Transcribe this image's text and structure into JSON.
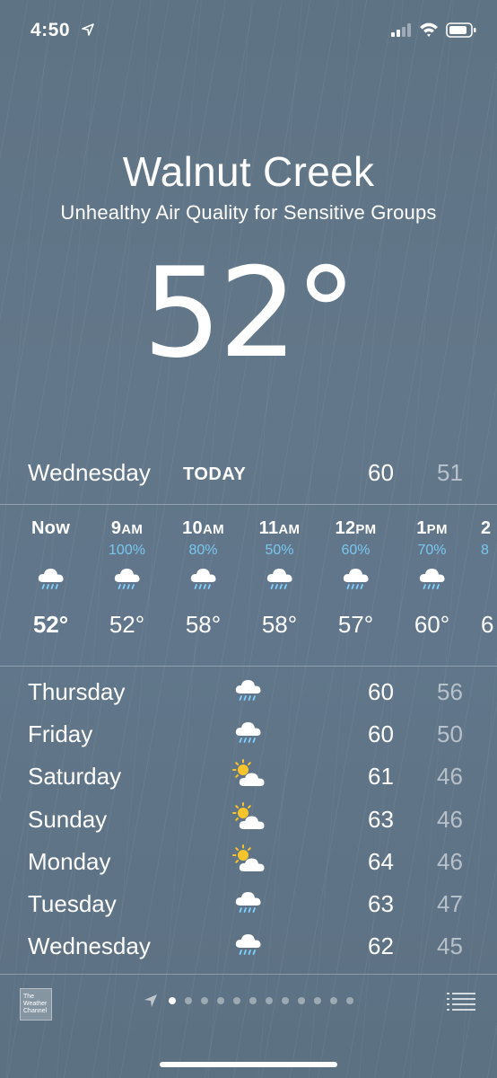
{
  "status_bar": {
    "time": "4:50"
  },
  "location": {
    "city": "Walnut Creek",
    "condition": "Unhealthy Air Quality for Sensitive Groups",
    "current_temp": "52°"
  },
  "today": {
    "day": "Wednesday",
    "tag": "TODAY",
    "high": "60",
    "low": "51"
  },
  "hourly": [
    {
      "label": "Now",
      "ampm": "",
      "pop": "",
      "icon": "rain-cloud-icon",
      "temp": "52°"
    },
    {
      "label": "9",
      "ampm": "AM",
      "pop": "100%",
      "icon": "rain-cloud-icon",
      "temp": "52°"
    },
    {
      "label": "10",
      "ampm": "AM",
      "pop": "80%",
      "icon": "rain-cloud-icon",
      "temp": "58°"
    },
    {
      "label": "11",
      "ampm": "AM",
      "pop": "50%",
      "icon": "rain-cloud-icon",
      "temp": "58°"
    },
    {
      "label": "12",
      "ampm": "PM",
      "pop": "60%",
      "icon": "rain-cloud-icon",
      "temp": "57°"
    },
    {
      "label": "1",
      "ampm": "PM",
      "pop": "70%",
      "icon": "rain-cloud-icon",
      "temp": "60°"
    },
    {
      "label": "2",
      "ampm": "",
      "pop": "8",
      "icon": "",
      "temp": "6"
    }
  ],
  "daily": [
    {
      "day": "Thursday",
      "icon": "rain-cloud-icon",
      "high": "60",
      "low": "56"
    },
    {
      "day": "Friday",
      "icon": "rain-cloud-icon",
      "high": "60",
      "low": "50"
    },
    {
      "day": "Saturday",
      "icon": "partly-sunny-icon",
      "high": "61",
      "low": "46"
    },
    {
      "day": "Sunday",
      "icon": "partly-sunny-icon",
      "high": "63",
      "low": "46"
    },
    {
      "day": "Monday",
      "icon": "partly-sunny-icon",
      "high": "64",
      "low": "46"
    },
    {
      "day": "Tuesday",
      "icon": "rain-cloud-icon",
      "high": "63",
      "low": "47"
    },
    {
      "day": "Wednesday",
      "icon": "rain-cloud-icon",
      "high": "62",
      "low": "45"
    }
  ],
  "footer": {
    "logo_text": "The Weather Channel",
    "page_count": 12,
    "active_page": 1
  },
  "colors": {
    "pop": "#79c7f0",
    "background": "#61768a"
  }
}
